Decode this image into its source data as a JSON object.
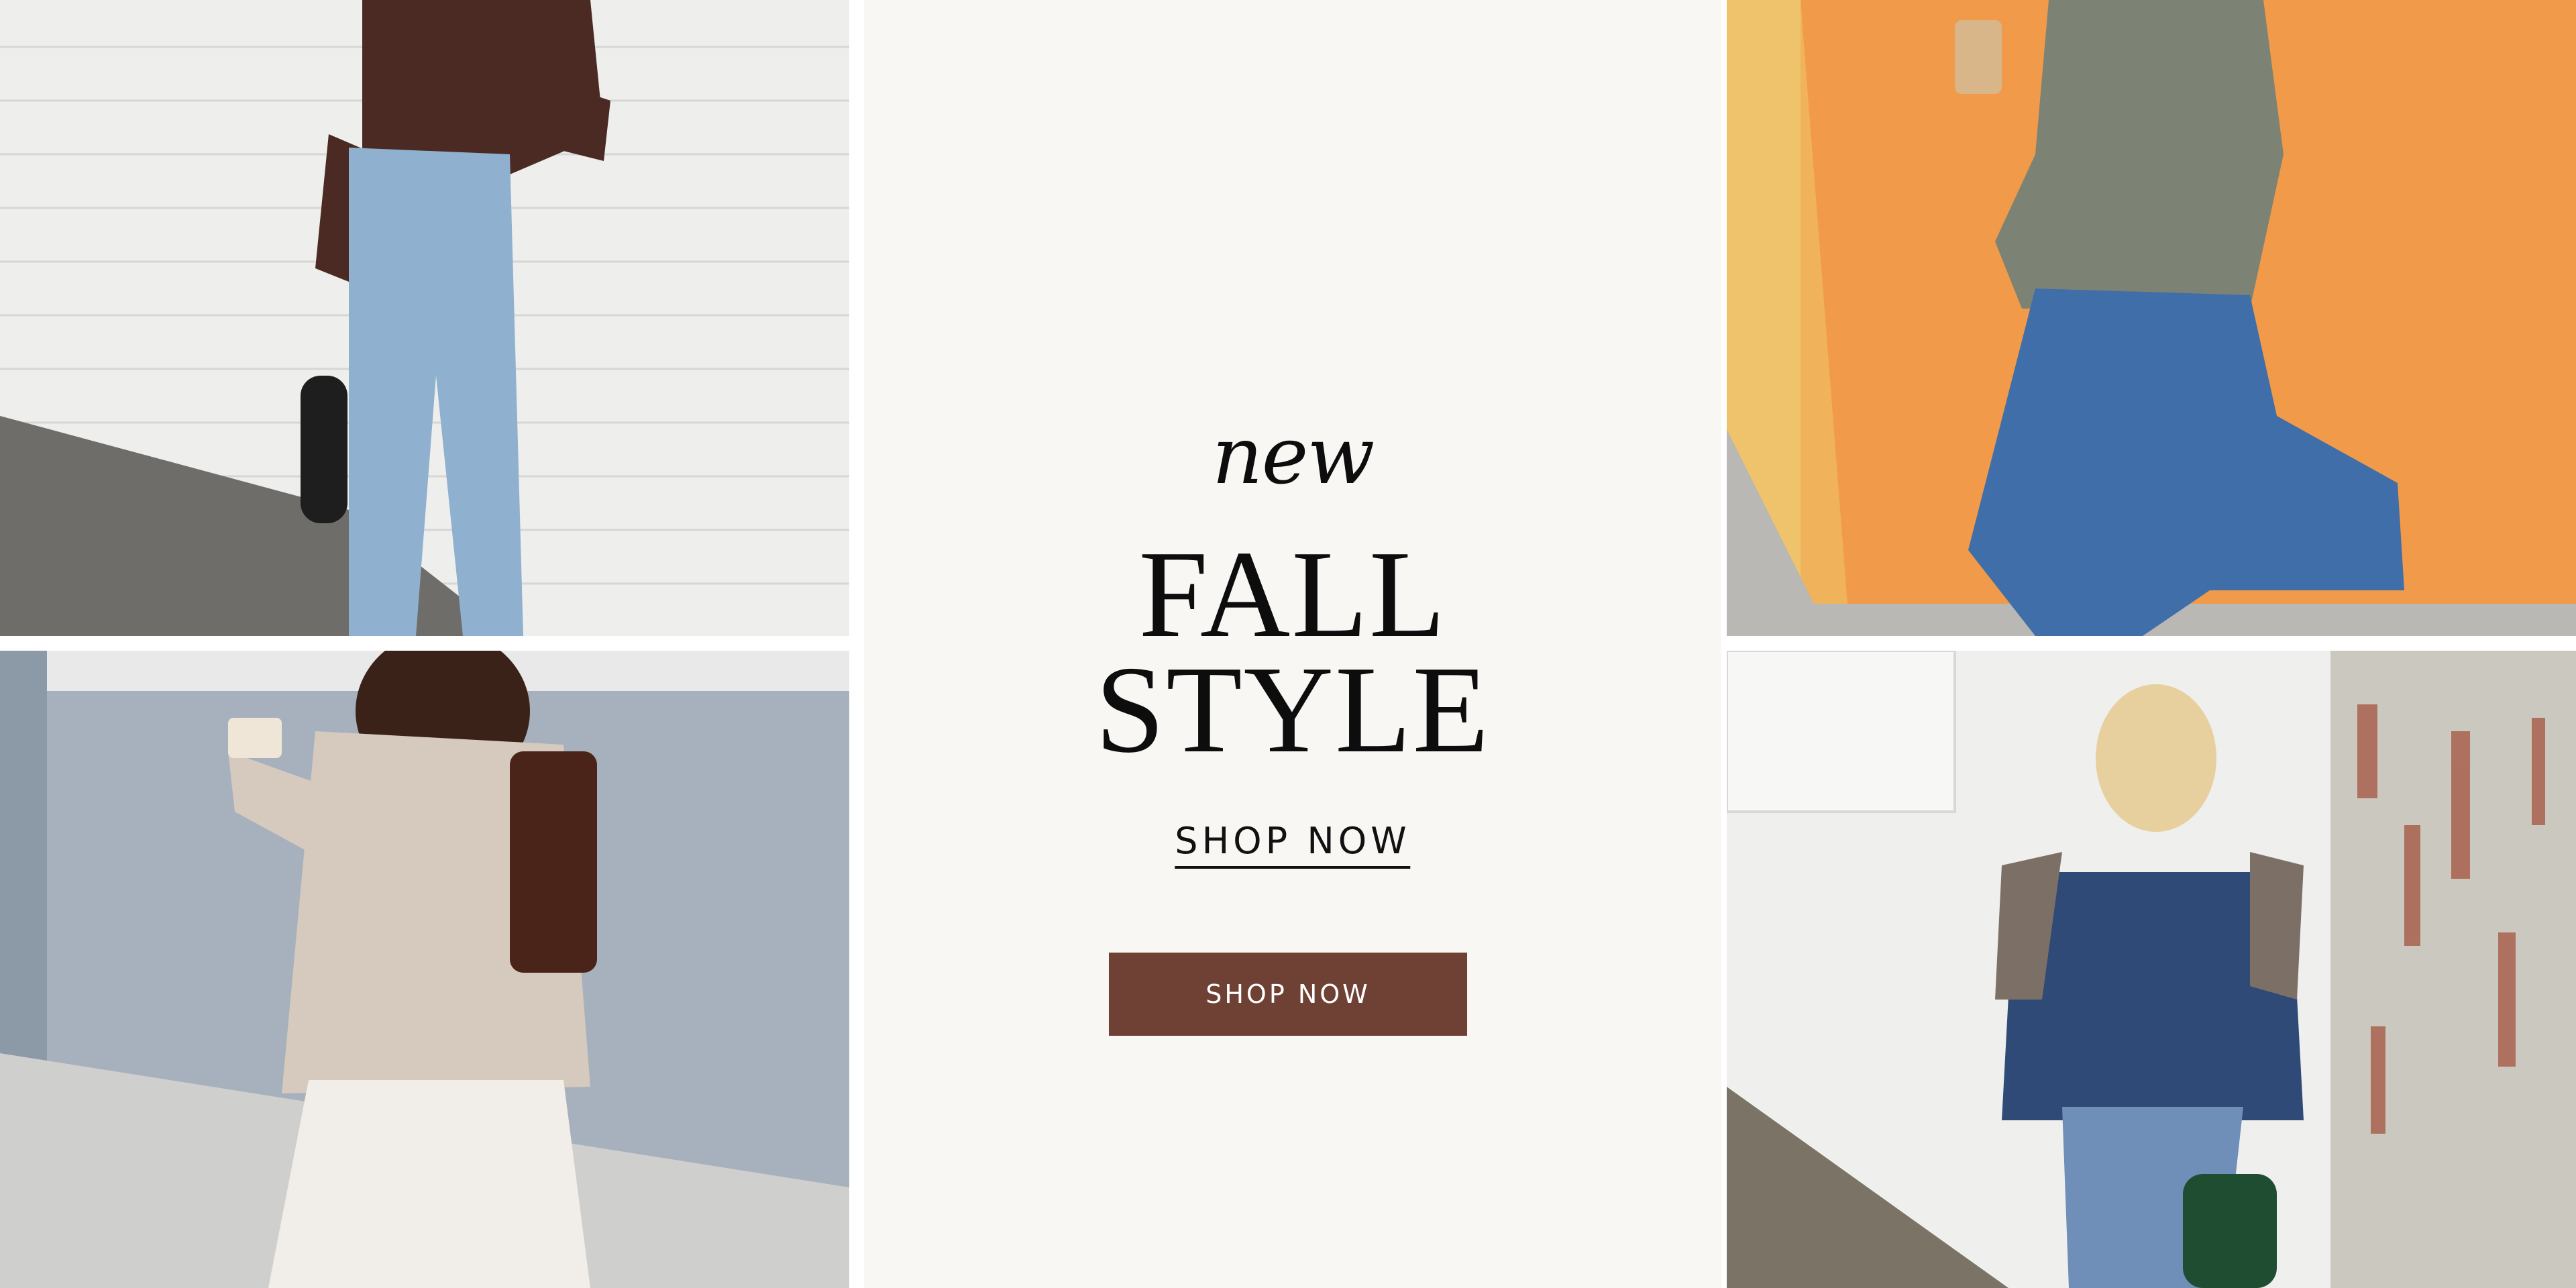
{
  "hero": {
    "eyebrow": "new",
    "title_line1": "FALL",
    "title_line2": "STYLE",
    "shop_link_label": "SHOP NOW",
    "shop_button_label": "SHOP NOW"
  },
  "colors": {
    "center_background": "#f8f7f4",
    "button_background": "#6f4134",
    "button_text": "#ffffff",
    "text": "#0d0d0d"
  },
  "images": [
    {
      "position": "top-left",
      "subject": "woman in brown top and light wash wide-leg jeans against white brick wall"
    },
    {
      "position": "bottom-left",
      "subject": "woman in oatmeal sweater and white lace skirt carrying coffee and brown tote"
    },
    {
      "position": "top-right",
      "subject": "woman in olive peplum top and flare jeans against orange wall"
    },
    {
      "position": "bottom-right",
      "subject": "woman in denim shirt with gray sweater and green handbag"
    }
  ]
}
